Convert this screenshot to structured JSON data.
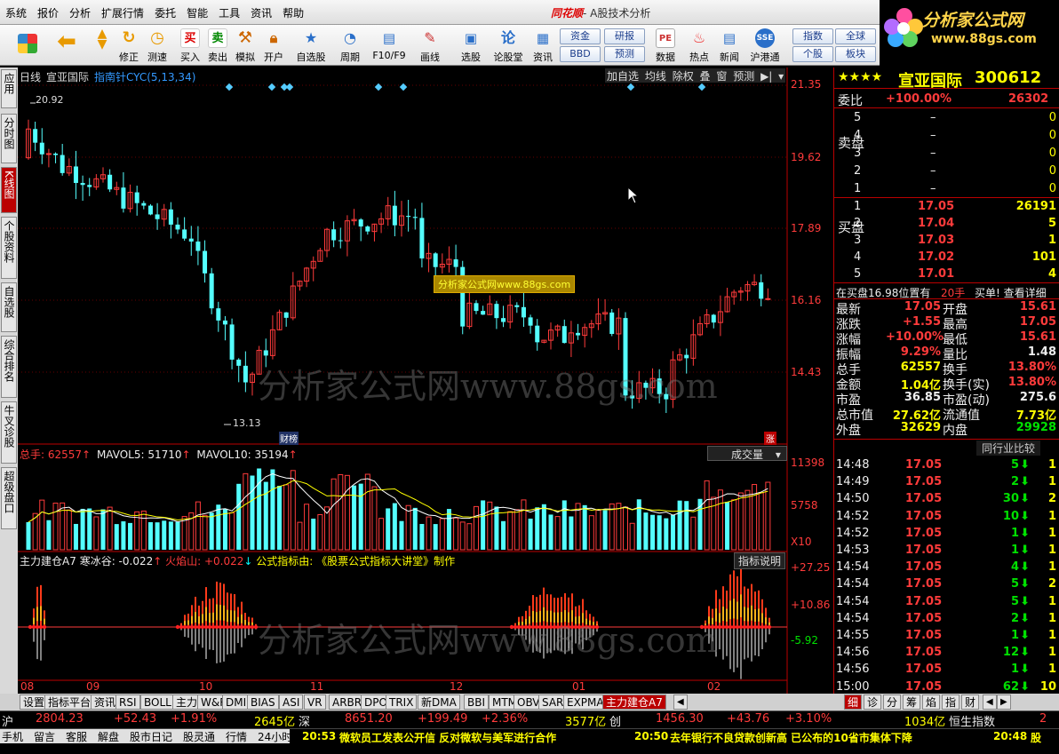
{
  "menu": {
    "items": [
      "系统",
      "报价",
      "分析",
      "扩展行情",
      "委托",
      "智能",
      "工具",
      "资讯",
      "帮助"
    ],
    "brand": "同花顺",
    "title_suffix": "- A股技术分析"
  },
  "toolbar": {
    "buttons": [
      "修正",
      "测速",
      "买入",
      "卖出",
      "模拟",
      "开户",
      "自选股",
      "周期",
      "F10/F9",
      "画线",
      "选股",
      "论股堂",
      "资讯",
      "数据",
      "热点",
      "新闻",
      "沪港通"
    ],
    "small_buttons": [
      "资金",
      "BBD",
      "研报",
      "预测",
      "指数",
      "个股",
      "全球",
      "板块"
    ]
  },
  "logo": {
    "name": "分析家公式网",
    "url": "www.88gs.com"
  },
  "left_tabs": [
    "应用",
    "分时图",
    "K线图",
    "个股资料",
    "自选股",
    "综合排名",
    "牛叉诊股",
    "超级盘口"
  ],
  "chart": {
    "period": "日线",
    "stock": "宣亚国际",
    "indicator_label": "指南针CYC(5,13,34)",
    "buttons": [
      "加自选",
      "均线",
      "除权",
      "叠",
      "窗",
      "预测"
    ],
    "price_axis": [
      "21.35",
      "19.62",
      "17.89",
      "16.16",
      "14.43"
    ],
    "max_label": "20.92",
    "min_label": "13.13",
    "watermark": "分析家公式网www.88gs.com",
    "inner_watermark": "分析家公式网www.88gs.com",
    "badge_finance": "财榜",
    "badge_rise": "涨",
    "volume": {
      "title": "总手: 62557",
      "mavol5": "MAVOL5: 51710",
      "mavol10": "MAVOL10: 35194",
      "selector": "成交量",
      "axis": [
        "11398",
        "5758",
        "X10"
      ]
    },
    "indicator": {
      "title": "主力建仓A7",
      "hbg": "寒冰谷: -0.022",
      "hys": "火焰山: +0.022",
      "credit": "公式指标由: 《股票公式指标大讲堂》制作",
      "help": "指标说明",
      "axis": [
        "+27.25",
        "+10.86",
        "-5.92"
      ]
    },
    "months": [
      "08",
      "09",
      "10",
      "11",
      "12",
      "01",
      "02"
    ]
  },
  "bottom_tabs": [
    "设置",
    "指标平台",
    "资讯",
    "RSI",
    "BOLL",
    "主力",
    "W&R",
    "DMI",
    "BIAS",
    "ASI",
    "VR",
    "ARBR",
    "DPO",
    "TRIX",
    "新DMA",
    "BBI",
    "MTM",
    "OBV",
    "SAR",
    "EXPMA",
    "主力建仓A7"
  ],
  "right_panel": {
    "stars": "★★★★",
    "name": "宣亚国际",
    "code": "300612",
    "weibi_label": "委比",
    "weibi": "+100.00%",
    "weicha": "26302",
    "sell_label": "卖盘",
    "buy_label": "买盘",
    "asks": [
      {
        "n": "5",
        "p": "–",
        "v": "0"
      },
      {
        "n": "4",
        "p": "–",
        "v": "0"
      },
      {
        "n": "3",
        "p": "–",
        "v": "0"
      },
      {
        "n": "2",
        "p": "–",
        "v": "0"
      },
      {
        "n": "1",
        "p": "–",
        "v": "0"
      }
    ],
    "bids": [
      {
        "n": "1",
        "p": "17.05",
        "v": "26191"
      },
      {
        "n": "2",
        "p": "17.04",
        "v": "5"
      },
      {
        "n": "3",
        "p": "17.03",
        "v": "1"
      },
      {
        "n": "4",
        "p": "17.02",
        "v": "101"
      },
      {
        "n": "5",
        "p": "17.01",
        "v": "4"
      }
    ],
    "notice": "在买盘16.98位置有",
    "notice_hands": "20手",
    "notice_link": "买单! 查看详细",
    "stats": [
      [
        "最新",
        "17.05",
        "开盘",
        "15.61"
      ],
      [
        "涨跌",
        "+1.55",
        "最高",
        "17.05"
      ],
      [
        "涨幅",
        "+10.00%",
        "最低",
        "15.61"
      ],
      [
        "振幅",
        "9.29%",
        "量比",
        "1.48"
      ],
      [
        "总手",
        "62557",
        "换手",
        "13.80%"
      ],
      [
        "金额",
        "1.04亿",
        "换手(实)",
        "13.80%"
      ],
      [
        "市盈",
        "36.85",
        "市盈(动)",
        "275.6"
      ],
      [
        "总市值",
        "27.62亿",
        "流通值",
        "7.73亿"
      ],
      [
        "外盘",
        "32629",
        "内盘",
        "29928"
      ]
    ],
    "peer_compare": "同行业比较",
    "ticks": [
      [
        "14:48",
        "17.05",
        "5",
        "1"
      ],
      [
        "14:49",
        "17.05",
        "2",
        "1"
      ],
      [
        "14:50",
        "17.05",
        "30",
        "2"
      ],
      [
        "14:52",
        "17.05",
        "10",
        "1"
      ],
      [
        "14:52",
        "17.05",
        "1",
        "1"
      ],
      [
        "14:53",
        "17.05",
        "1",
        "1"
      ],
      [
        "14:54",
        "17.05",
        "4",
        "1"
      ],
      [
        "14:54",
        "17.05",
        "5",
        "2"
      ],
      [
        "14:54",
        "17.05",
        "5",
        "1"
      ],
      [
        "14:54",
        "17.05",
        "2",
        "1"
      ],
      [
        "14:55",
        "17.05",
        "1",
        "1"
      ],
      [
        "14:56",
        "17.05",
        "12",
        "1"
      ],
      [
        "14:56",
        "17.05",
        "1",
        "1"
      ],
      [
        "15:00",
        "17.05",
        "62",
        "10"
      ]
    ],
    "tabs": [
      "细",
      "诊",
      "分",
      "筹",
      "焰",
      "指",
      "财"
    ]
  },
  "status": {
    "sh_label": "沪",
    "sh": "2804.23",
    "sh_chg": "+52.43",
    "sh_pct": "+1.91%",
    "sh_amt": "2645亿",
    "sz_label": "深",
    "sz": "8651.20",
    "sz_chg": "+199.49",
    "sz_pct": "+2.36%",
    "sz_amt": "3577亿",
    "cy_label": "创",
    "cy": "1456.30",
    "cy_chg": "+43.76",
    "cy_pct": "+3.10%",
    "hs_amt": "1034亿",
    "hs_label": "恒生指数",
    "hs_val": "2"
  },
  "bottom": {
    "links": [
      "手机",
      "留言",
      "客服",
      "解盘",
      "股市日记",
      "股灵通",
      "行情",
      "24小时滚动"
    ],
    "news1_time": "20:53",
    "news1": "微软员工发表公开信 反对微软与美军进行合作",
    "news2_time": "20:50",
    "news2": "去年银行不良贷款创新高 已公布的10省市集体下降",
    "news3_time": "20:48",
    "news3": "股"
  }
}
